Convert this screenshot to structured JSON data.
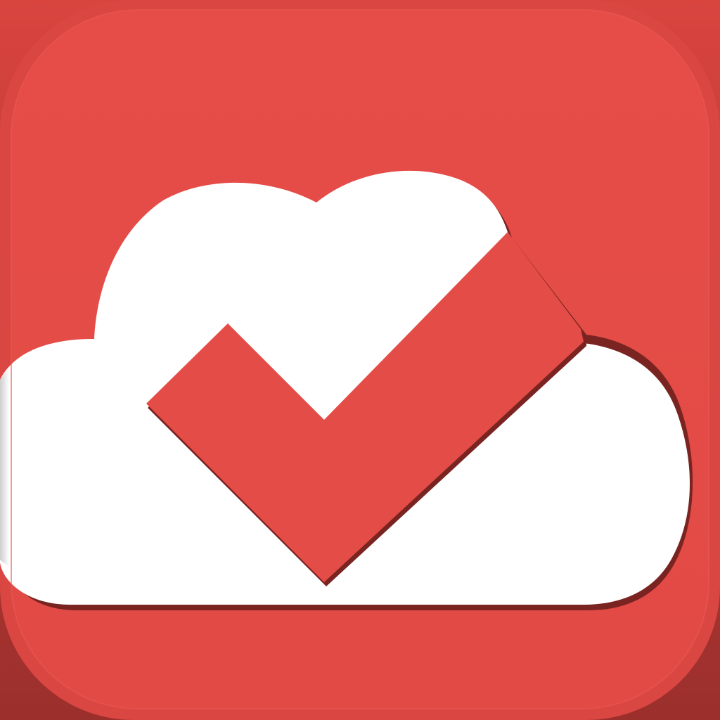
{
  "app_icon": {
    "name": "cloud-checkmark",
    "icon": "cloud-check-icon",
    "colors": {
      "background": "#e44c47",
      "background_edge": "#9b2f2c",
      "cloud": "#ffffff",
      "shadow": "#7a2422"
    }
  }
}
